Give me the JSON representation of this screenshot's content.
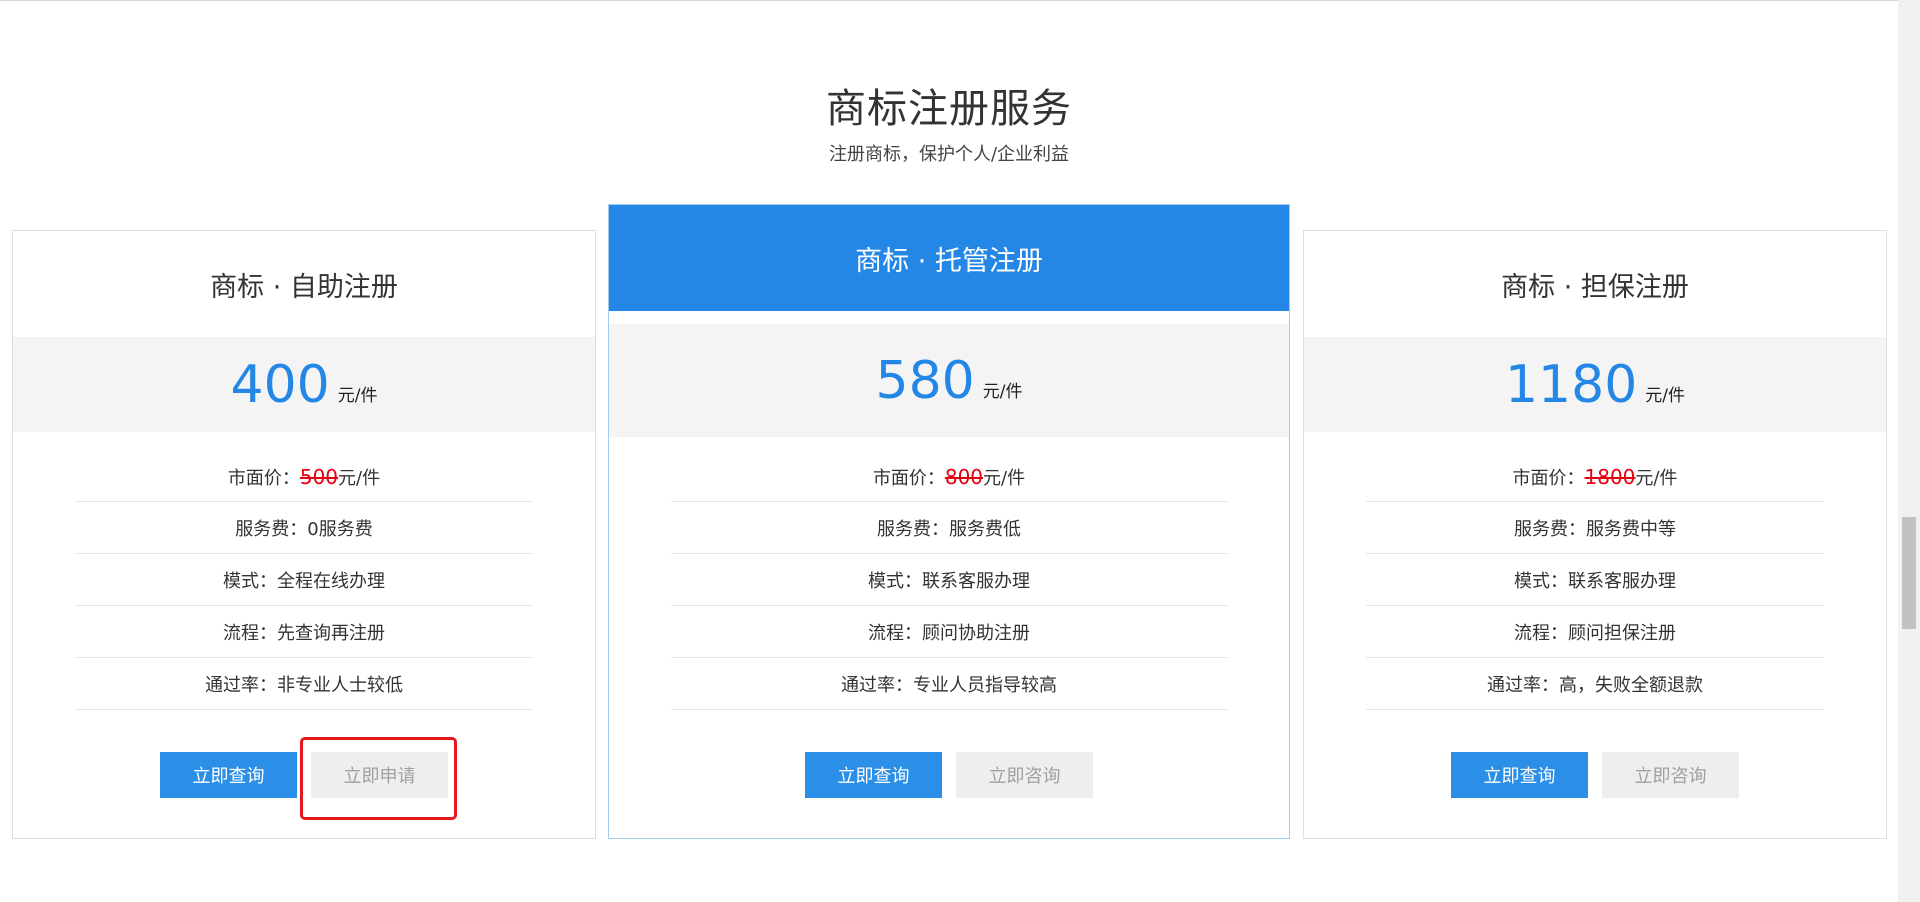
{
  "section": {
    "title": "商标注册服务",
    "subtitle": "注册商标，保护个人/企业利益"
  },
  "accent_color": "#2487e6",
  "strike_color": "#e60012",
  "plans": [
    {
      "name": "商标 · 自助注册",
      "price": "400",
      "unit": "元/件",
      "market_label": "市面价：",
      "market_price": "500",
      "market_unit": "元/件",
      "service": "服务费：0服务费",
      "mode": "模式：全程在线办理",
      "process": "流程：先查询再注册",
      "pass_rate": "通过率：非专业人士较低",
      "btn_primary": "立即查询",
      "btn_secondary": "立即申请"
    },
    {
      "name": "商标 · 托管注册",
      "price": "580",
      "unit": "元/件",
      "market_label": "市面价：",
      "market_price": "800",
      "market_unit": "元/件",
      "service": "服务费：服务费低",
      "mode": "模式：联系客服办理",
      "process": "流程：顾问协助注册",
      "pass_rate": "通过率：专业人员指导较高",
      "btn_primary": "立即查询",
      "btn_secondary": "立即咨询"
    },
    {
      "name": "商标 · 担保注册",
      "price": "1180",
      "unit": "元/件",
      "market_label": "市面价：",
      "market_price": "1800",
      "market_unit": "元/件",
      "service": "服务费：服务费中等",
      "mode": "模式：联系客服办理",
      "process": "流程：顾问担保注册",
      "pass_rate": "通过率：高，失败全额退款",
      "btn_primary": "立即查询",
      "btn_secondary": "立即咨询"
    }
  ]
}
